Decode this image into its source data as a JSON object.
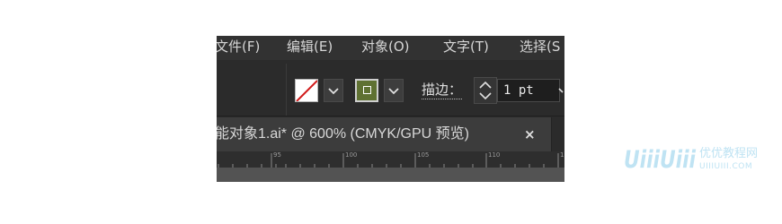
{
  "menu": {
    "items": [
      {
        "label": "文件(F)"
      },
      {
        "label": "编辑(E)"
      },
      {
        "label": "对象(O)"
      },
      {
        "label": "文字(T)"
      },
      {
        "label": "选择(S"
      }
    ]
  },
  "control_bar": {
    "fill_swatch": {
      "state": "none",
      "icon": "none-swatch-icon"
    },
    "stroke_swatch": {
      "color": "#5f7132",
      "icon": "stroke-swatch-icon"
    },
    "stroke_label": "描边：",
    "stroke_weight": "1 pt"
  },
  "document_tab": {
    "title": "能对象1.ai* @ 600% (CMYK/GPU 预览)",
    "close_symbol": "×"
  },
  "ruler": {
    "labels": [
      "95",
      "100",
      "105",
      "110",
      "1"
    ]
  },
  "watermark": {
    "logo": "UiiiUiii",
    "text_cn": "优优教程网",
    "url": "UIIIUIII.COM",
    "color": "#bfe3f3"
  }
}
